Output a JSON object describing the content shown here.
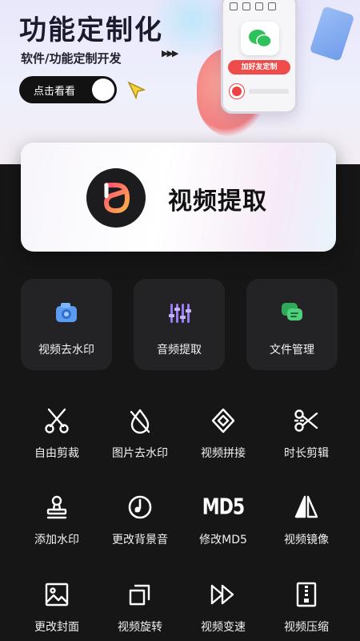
{
  "banner": {
    "title": "功能定制化",
    "subtitle": "软件/功能定制开发",
    "cta_label": "点击看看",
    "phone_button": "加好友定制"
  },
  "hero": {
    "title": "视频提取",
    "accent_colors": [
      "#ff5a6e",
      "#ffb347"
    ]
  },
  "feature_cards": [
    {
      "label": "视频去水印",
      "icon": "camera-icon",
      "color": "#5b9bf0"
    },
    {
      "label": "音频提取",
      "icon": "equalizer-icon",
      "color": "#9a7cf2"
    },
    {
      "label": "文件管理",
      "icon": "chat-folder-icon",
      "color": "#3fbf6b"
    }
  ],
  "tools": [
    {
      "label": "自由剪裁",
      "icon": "scissors-icon"
    },
    {
      "label": "图片去水印",
      "icon": "no-drop-icon"
    },
    {
      "label": "视频拼接",
      "icon": "merge-diamond-icon"
    },
    {
      "label": "时长剪辑",
      "icon": "cut-timeline-icon"
    },
    {
      "label": "添加水印",
      "icon": "stamp-icon"
    },
    {
      "label": "更改背景音",
      "icon": "music-clock-icon"
    },
    {
      "label": "修改MD5",
      "icon": "md5-icon",
      "icon_text": "MD5"
    },
    {
      "label": "视频镜像",
      "icon": "mirror-icon"
    },
    {
      "label": "更改封面",
      "icon": "image-icon"
    },
    {
      "label": "视频旋转",
      "icon": "rotate-icon"
    },
    {
      "label": "视频变速",
      "icon": "fast-forward-icon"
    },
    {
      "label": "视频压缩",
      "icon": "zip-icon"
    }
  ]
}
